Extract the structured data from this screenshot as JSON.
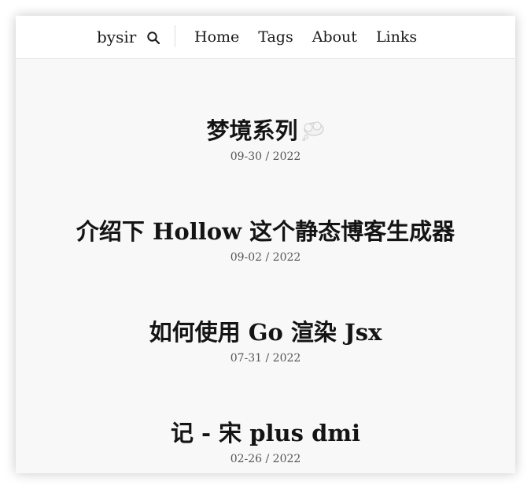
{
  "header": {
    "brand": "bysir",
    "search_icon": "search-icon",
    "nav": [
      "Home",
      "Tags",
      "About",
      "Links"
    ]
  },
  "posts": [
    {
      "title": "梦境系列",
      "emoji": "thought-balloon-icon",
      "date": "09-30 / 2022"
    },
    {
      "title": "介绍下 Hollow 这个静态博客生成器",
      "date": "09-02 / 2022"
    },
    {
      "title": "如何使用 Go 渲染 Jsx",
      "date": "07-31 / 2022"
    },
    {
      "title": "记 - 宋 plus dmi",
      "date": "02-26 / 2022"
    }
  ]
}
